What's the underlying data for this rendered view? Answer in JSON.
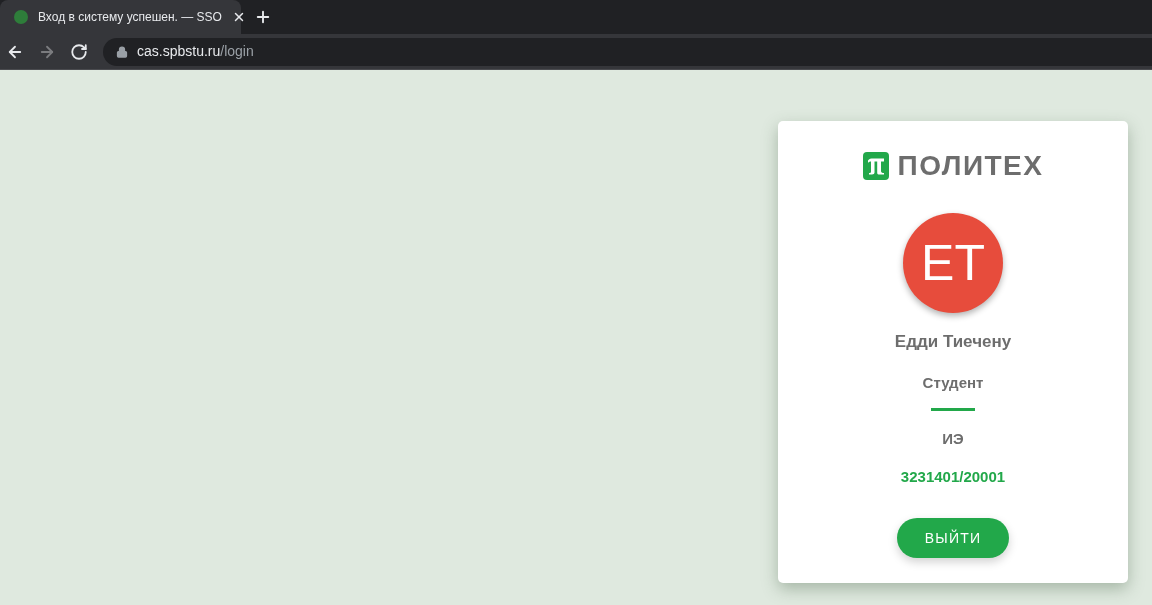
{
  "browser": {
    "tabs": [
      {
        "title": "Вход в систему успешен. — SSO",
        "selected": true
      }
    ],
    "nav_buttons": [
      {
        "kind": "back",
        "disabled": false
      },
      {
        "kind": "forward",
        "disabled": true
      },
      {
        "kind": "reload",
        "disabled": false
      }
    ],
    "address": {
      "host": "cas.spbstu.ru",
      "path": "/login"
    }
  },
  "card": {
    "logo": {
      "text": "ПОЛИТЕХ"
    },
    "avatar": {
      "initials": "ET"
    },
    "name": "Едди Тиечену",
    "role": "Студент",
    "department": "ИЭ",
    "group": "3231401/20001",
    "button": {
      "label": "ВЫЙТИ"
    }
  }
}
